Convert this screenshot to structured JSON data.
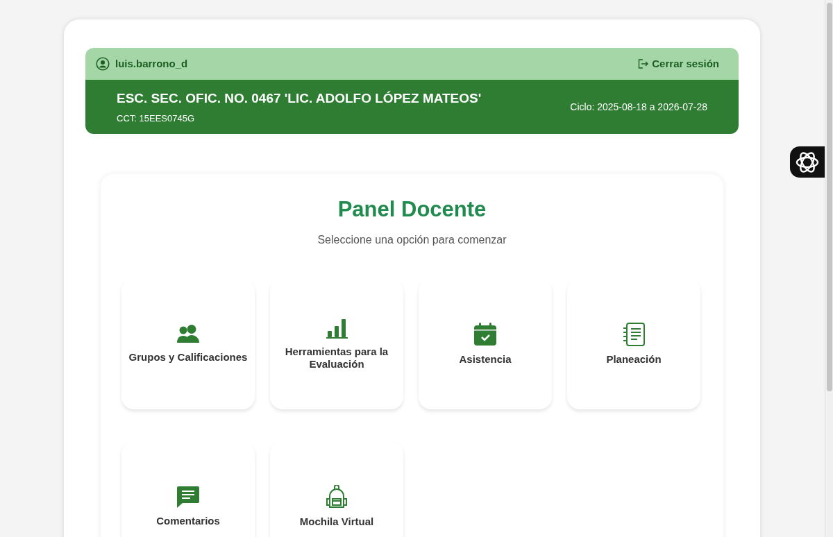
{
  "user_bar": {
    "username": "luis.barrono_d",
    "logout": "Cerrar sesión"
  },
  "school": {
    "name": "ESC. SEC. OFIC. NO. 0467 'LIC. ADOLFO LÓPEZ MATEOS'",
    "cct": "CCT: 15EES0745G",
    "cycle": "Ciclo: 2025-08-18 a 2026-07-28"
  },
  "panel": {
    "title": "Panel Docente",
    "subtitle": "Seleccione una opción para comenzar"
  },
  "options": [
    {
      "label": "Grupos y Calificaciones"
    },
    {
      "label": "Herramientas para la Evaluación"
    },
    {
      "label": "Asistencia"
    },
    {
      "label": "Planeación"
    },
    {
      "label": "Comentarios"
    },
    {
      "label": "Mochila Virtual"
    }
  ]
}
